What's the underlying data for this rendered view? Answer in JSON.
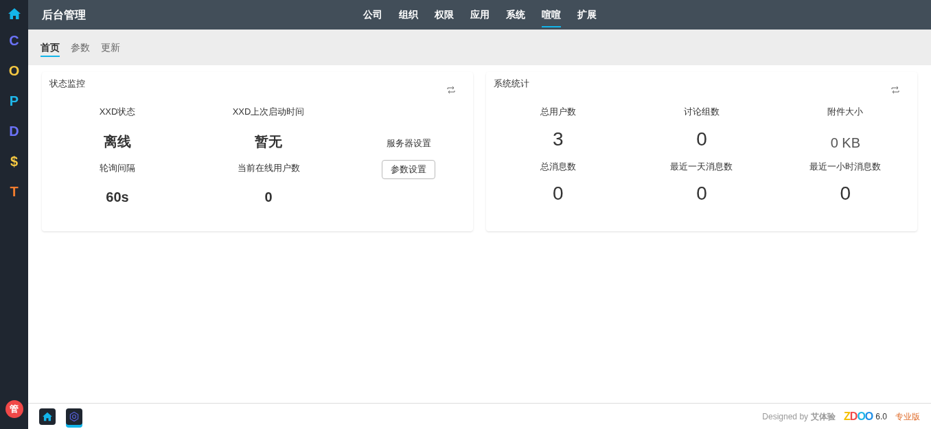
{
  "app_bar": [
    {
      "label": "C",
      "color": "#6c73f8"
    },
    {
      "label": "O",
      "color": "#f5c842"
    },
    {
      "label": "P",
      "color": "#1fb6e8"
    },
    {
      "label": "D",
      "color": "#6c73f8"
    },
    {
      "label": "$",
      "color": "#f5c842"
    },
    {
      "label": "T",
      "color": "#f07c2e"
    }
  ],
  "user_badge": "管",
  "header": {
    "title": "后台管理",
    "nav": [
      {
        "label": "公司",
        "selected": false
      },
      {
        "label": "组织",
        "selected": false
      },
      {
        "label": "权限",
        "selected": false
      },
      {
        "label": "应用",
        "selected": false
      },
      {
        "label": "系统",
        "selected": false
      },
      {
        "label": "喧喧",
        "selected": true
      },
      {
        "label": "扩展",
        "selected": false
      }
    ]
  },
  "subnav": [
    {
      "label": "首页",
      "selected": true
    },
    {
      "label": "参数",
      "selected": false
    },
    {
      "label": "更新",
      "selected": false
    }
  ],
  "status_card": {
    "title": "状态监控",
    "items": [
      {
        "label": "XXD状态",
        "value": "离线"
      },
      {
        "label": "XXD上次启动时间",
        "value": "暂无"
      },
      {
        "label": "轮询间隔",
        "value": "60s"
      },
      {
        "label": "当前在线用户数",
        "value": "0"
      }
    ],
    "server_label": "服务器设置",
    "server_button": "参数设置"
  },
  "stats_card": {
    "title": "系统统计",
    "items": [
      {
        "label": "总用户数",
        "value": "3"
      },
      {
        "label": "讨论组数",
        "value": "0"
      },
      {
        "label": "附件大小",
        "value": "0 KB",
        "small": true
      },
      {
        "label": "总消息数",
        "value": "0"
      },
      {
        "label": "最近一天消息数",
        "value": "0"
      },
      {
        "label": "最近一小时消息数",
        "value": "0"
      }
    ]
  },
  "taskbar": [
    {
      "kind": "home",
      "selected": false
    },
    {
      "kind": "hexagon",
      "selected": true
    }
  ],
  "footer": {
    "designed_by": "Designed by",
    "designer": "艾体验",
    "logo": "ZDOO",
    "version": "6.0",
    "edition": "专业版"
  }
}
